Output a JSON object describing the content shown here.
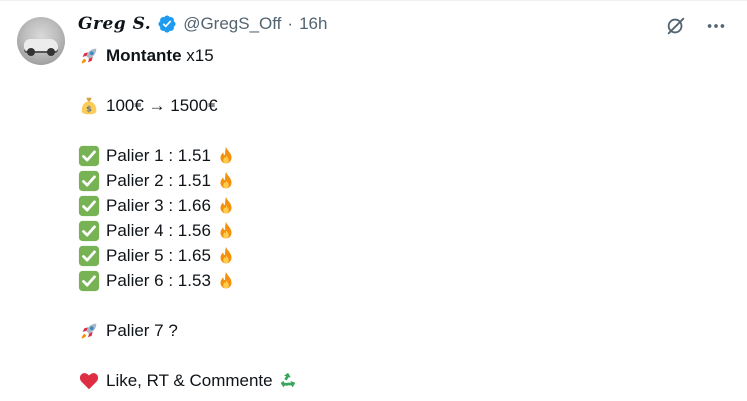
{
  "author": {
    "name": "Greg S.",
    "handle": "@GregS_Off",
    "separator": "·",
    "time": "16h"
  },
  "icons": {
    "verified": "verified-badge-icon",
    "grok": "grok-icon",
    "more": "more-options-icon",
    "rocket": "rocket-icon",
    "money_bag": "money-bag-icon",
    "check": "check-mark-icon",
    "fire": "fire-icon",
    "heart": "red-heart-icon",
    "recycle": "recycle-icon"
  },
  "colors": {
    "verified_blue": "#1d9bf0",
    "check_green": "#3aa55d",
    "heart_red": "#e0245e",
    "secondary_text": "#536471"
  },
  "post": {
    "title_bold": "Montante",
    "title_rest": " x15",
    "stake": "100€ → 1500€",
    "paliers": [
      {
        "text": "Palier 1 : 1.51"
      },
      {
        "text": "Palier 2 : 1.51"
      },
      {
        "text": "Palier 3 : 1.66"
      },
      {
        "text": "Palier 4 : 1.56"
      },
      {
        "text": "Palier 5 : 1.65"
      },
      {
        "text": "Palier 6 : 1.53"
      }
    ],
    "next": "Palier 7 ?",
    "cta": "Like, RT & Commente"
  }
}
